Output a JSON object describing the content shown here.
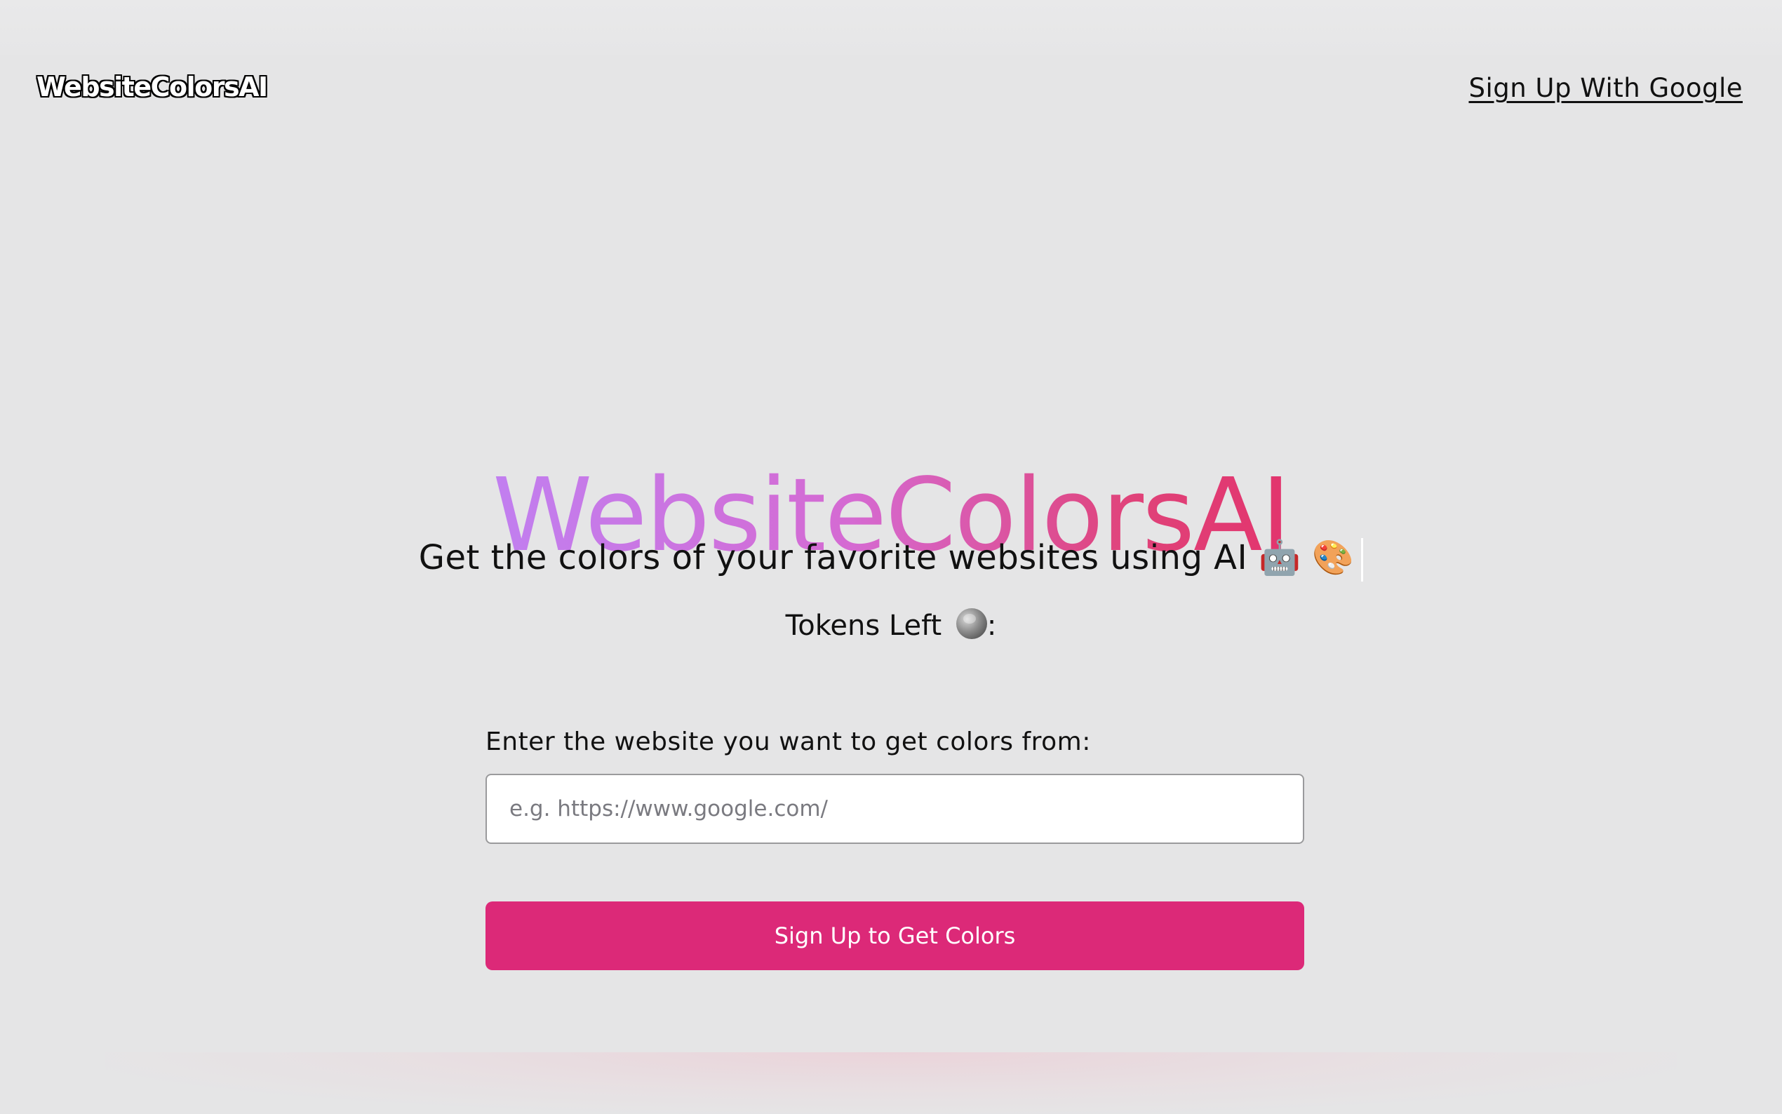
{
  "navbar": {
    "brand": "WebsiteColorsAI",
    "signup_link": "Sign Up With Google"
  },
  "hero": {
    "title": "WebsiteColorsAI",
    "subtitle_text": "Get the colors of your favorite websites using AI",
    "subtitle_emoji_robot": "🤖",
    "subtitle_emoji_palette": "🎨",
    "tokens_label": "Tokens Left",
    "tokens_suffix": ":"
  },
  "form": {
    "label": "Enter the website you want to get colors from:",
    "input_value": "",
    "input_placeholder": "e.g. https://www.google.com/",
    "button_label": "Sign Up to Get Colors"
  },
  "colors": {
    "accent": "#dc2978",
    "title_gradient_start": "#c17ff0",
    "title_gradient_end": "#e2346d",
    "background": "#e5e5e6"
  },
  "icons": {
    "robot": "robot-face-icon",
    "palette": "artist-palette-icon",
    "tokens": "globe-icon"
  }
}
